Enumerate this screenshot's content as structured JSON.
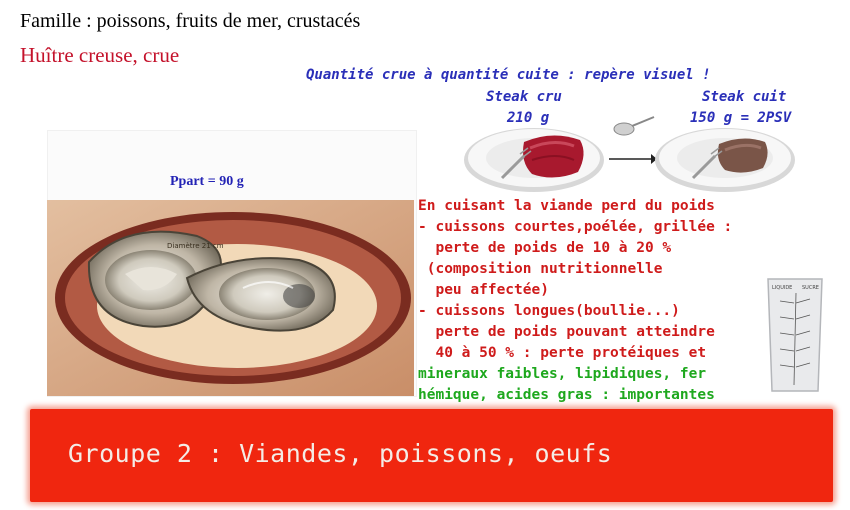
{
  "header": {
    "family": "Famille : poissons, fruits de mer, crustacés",
    "food": "Huître creuse, crue"
  },
  "visual_guide": {
    "title": "Quantité crue à quantité cuite : repère visuel !",
    "raw_label": "Steak cru",
    "raw_weight": "210 g",
    "cooked_label": "Steak cuit",
    "cooked_weight": "150 g = 2PSV"
  },
  "portion": {
    "label": "Ppart = 90 g",
    "tray_text": "Diamètre 21 cm"
  },
  "cooking_notes": {
    "lines_red": [
      "En cuisant la viande perd du poids",
      "- cuissons courtes,poélée, grillée :",
      "  perte de poids de 10 à 20 %",
      " (composition nutritionnelle",
      "  peu affectée)",
      "- cuissons longues(boullie...)",
      "  perte de poids pouvant atteindre",
      "  40 à 50 % : perte protéiques et"
    ],
    "lines_green": [
      "mineraux faibles, lipidiques, fer",
      "hémique, acides gras : importantes"
    ]
  },
  "cup_labels": {
    "left": "LIQUIDE",
    "right": "SUCRE"
  },
  "banner": {
    "text": "Groupe 2 : Viandes, poissons, oeufs"
  },
  "colors": {
    "banner": "#f0260f",
    "food_title": "#c4122b",
    "guide_text": "#2a2fb8"
  }
}
